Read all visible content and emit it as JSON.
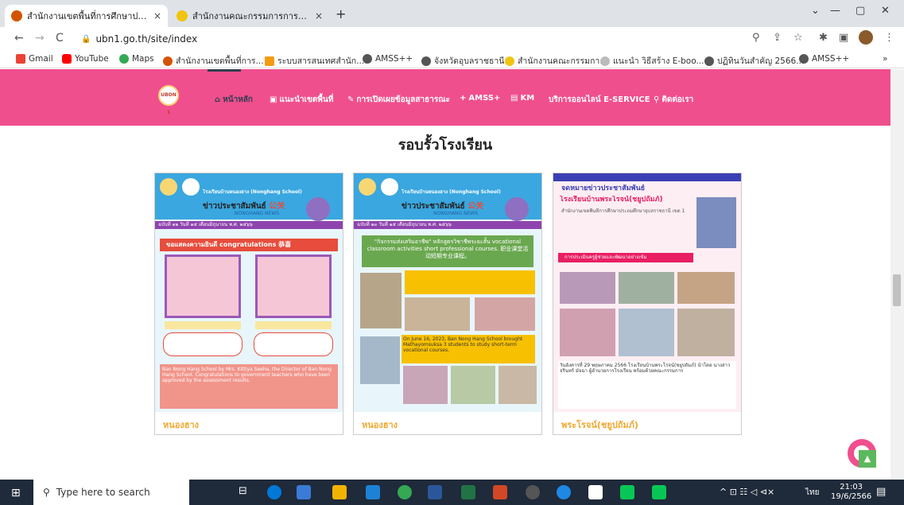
{
  "tabs": [
    {
      "title": "สำนักงานเขตพื้นที่การศึกษาประถมศึก",
      "close": "×",
      "color": "#d35400"
    },
    {
      "title": "สำนักงานคณะกรรมการการศึกษาขั้นพื้",
      "close": "×",
      "color": "#f1c40f"
    }
  ],
  "new_tab": "+",
  "window": {
    "chevron": "⌄",
    "min": "—",
    "restore": "▢",
    "close": "✕"
  },
  "address": {
    "url": "ubn1.go.th/site/index",
    "back": "←",
    "forward": "→",
    "reload": "C"
  },
  "bookmarks": [
    {
      "label": "Gmail",
      "color": "#ea4335"
    },
    {
      "label": "YouTube",
      "color": "#ff0000"
    },
    {
      "label": "Maps",
      "color": "#34a853"
    },
    {
      "label": "สำนักงานเขตพื้นที่การ...",
      "color": "#d35400"
    },
    {
      "label": "ระบบสารสนเทศสำนัก...",
      "color": "#f39c12"
    },
    {
      "label": "AMSS++",
      "color": "#555"
    },
    {
      "label": "จังหวัดอุบลราชธานี",
      "color": "#555"
    },
    {
      "label": "สำนักงานคณะกรรมกา...",
      "color": "#f1c40f"
    },
    {
      "label": "แนะนำ วิธีสร้าง E-boo...",
      "color": "#999"
    },
    {
      "label": "ปฏิทินวันสำคัญ 2566...",
      "color": "#555"
    },
    {
      "label": "AMSS++",
      "color": "#555"
    }
  ],
  "bookmarks_more": "»",
  "site": {
    "logo_text": "UBON 1",
    "nav": [
      {
        "label": "หน้าหลัก",
        "icon": "⌂"
      },
      {
        "label": "แนะนำเขตพื้นที่",
        "icon": "▣"
      },
      {
        "label": "การเปิดเผยข้อมูลสาธารณะ",
        "icon": "✎"
      },
      {
        "label": "AMSS+",
        "icon": "+"
      },
      {
        "label": "KM",
        "icon": "▤"
      },
      {
        "label": "บริการออนไลน์ E-SERVICE",
        "icon": ""
      },
      {
        "label": "ติดต่อเรา",
        "icon": "⚲"
      }
    ]
  },
  "section_title": "รอบรั้วโรงเรียน",
  "cards": [
    {
      "caption": "หนองฮาง",
      "school": "โรงเรียนบ้านหนองฮาง (Nonghang School)",
      "headline": "ข่าวประชาสัมพันธ์",
      "tag": "公关",
      "sub": "NONGHANG NEWS",
      "issue": "ฉบับที่ ๑๒ วันที่ ๑๕ เดือนมิถุนายน พ.ศ. ๒๕๖๖",
      "banner": "ขอแสดงความยินดี congratulations 恭喜",
      "body": "Ban Nong Hang School by Mrs. Kittiya Seeha, the Director of Ban Nong Hang School. Congratulations to government teachers who have been approved by the assessment results."
    },
    {
      "caption": "หนองฮาง",
      "school": "โรงเรียนบ้านหนองฮาง (Nonghang School)",
      "headline": "ข่าวประชาสัมพันธ์",
      "tag": "公关",
      "sub": "NONGHANG NEWS",
      "issue": "ฉบับที่ ๑๓ วันที่ ๑๕ เดือนมิถุนายน พ.ศ. ๒๕๖๖",
      "banner": "\"กิจกรรมส่งเสริมอาชีพ\" หลักสูตรวิชาชีพระยะสั้น vocational classroom activities short professional courses. 职业课堂活动短期专业课程。",
      "body": "On June 16, 2023, Ban Nong Hang School brought Mathayomsuksa 3 students to study short-term vocational courses."
    },
    {
      "caption": "พระโรจน์(ชยูปถัมภ์)",
      "school": "โรงเรียนบ้านพระโรจน์(ชยูปถัมภ์)",
      "headline": "จดหมายข่าวประชาสัมพันธ์",
      "tag": "",
      "sub": "สำนักงานเขตพื้นที่การศึกษาประถมศึกษาอุบลราชธานี เขต 1",
      "issue": "",
      "banner": "การประเมินครูผู้ช่วยและพัฒนาอย่างเข้ม",
      "body": "วันอังคารที่ 29 พฤษภาคม 2566 โรงเรียนบ้านพระโรจน์(ชยูปถัมภ์) นำโดย นางสาวจรินทร์ มัจฉา ผู้อำนวยการโรงเรียน พร้อมด้วยคณะกรรมการ"
    }
  ],
  "taskbar": {
    "search_placeholder": "Type here to search",
    "time": "21:03",
    "date": "19/6/2566",
    "lang": "ไทย",
    "sys_icons": "^ ⊡ ☷ ◁ ⊲×"
  },
  "colors": {
    "nav_pink": "#f04f8d",
    "tabbar": "#dfe3e8",
    "taskbar": "#1f2a3a"
  }
}
